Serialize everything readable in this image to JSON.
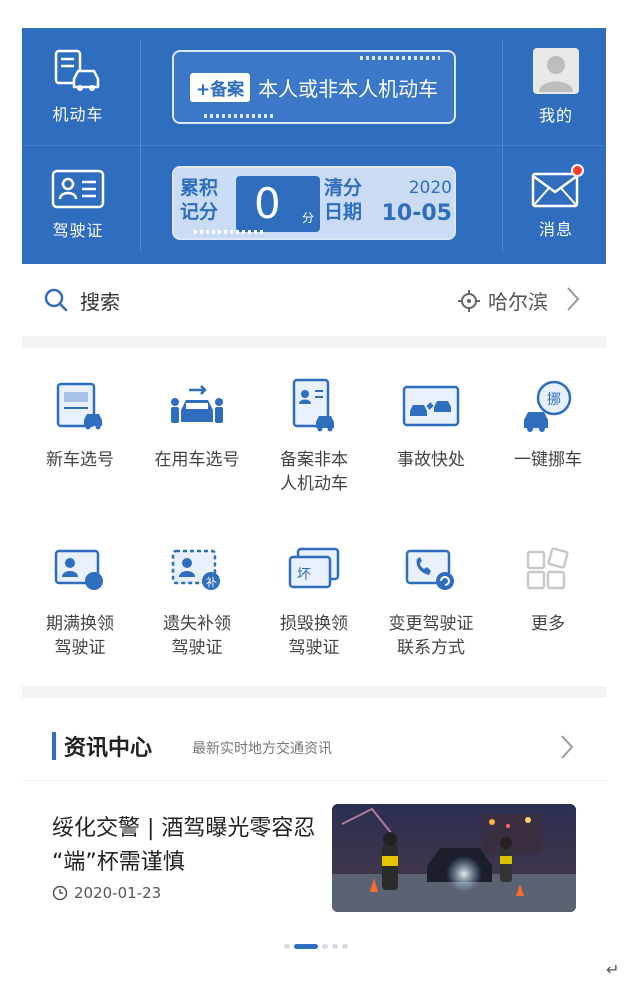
{
  "header": {
    "left_top_label": "机动车",
    "left_bottom_label": "驾驶证",
    "right_top_label": "我的",
    "right_bottom_label": "消息",
    "register_card": {
      "tag": "+备案",
      "text": "本人或非本人机动车"
    },
    "score_card": {
      "accumulated_label_1": "累积",
      "accumulated_label_2": "记分",
      "points": "0",
      "points_unit": "分",
      "clear_label_1": "清分",
      "clear_label_2": "日期",
      "clear_year": "2020",
      "clear_date": "10-05"
    }
  },
  "search": {
    "label": "搜索",
    "city": "哈尔滨"
  },
  "services": [
    {
      "label": "新车选号",
      "icon": "new-car-plate-icon"
    },
    {
      "label": "在用车选号",
      "icon": "in-use-car-plate-icon"
    },
    {
      "label": "备案非本\n人机动车",
      "icon": "register-vehicle-icon"
    },
    {
      "label": "事故快处",
      "icon": "accident-icon"
    },
    {
      "label": "一键挪车",
      "icon": "move-car-icon"
    },
    {
      "label": "期满换领\n驾驶证",
      "icon": "license-renew-icon"
    },
    {
      "label": "遗失补领\n驾驶证",
      "icon": "license-replace-icon"
    },
    {
      "label": "损毁换领\n驾驶证",
      "icon": "license-damaged-icon"
    },
    {
      "label": "变更驾驶证\n联系方式",
      "icon": "license-contact-icon"
    },
    {
      "label": "更多",
      "icon": "more-icon"
    }
  ],
  "news": {
    "title": "资讯中心",
    "subtitle": "最新实时地方交通资讯",
    "article": {
      "title": "绥化交警 | 酒驾曝光零容忍 “端”杯需谨慎",
      "date": "2020-01-23"
    },
    "pager_total": 5,
    "pager_active": 1
  },
  "colors": {
    "brand": "#2f6dbf",
    "badge": "#ff3b30"
  }
}
